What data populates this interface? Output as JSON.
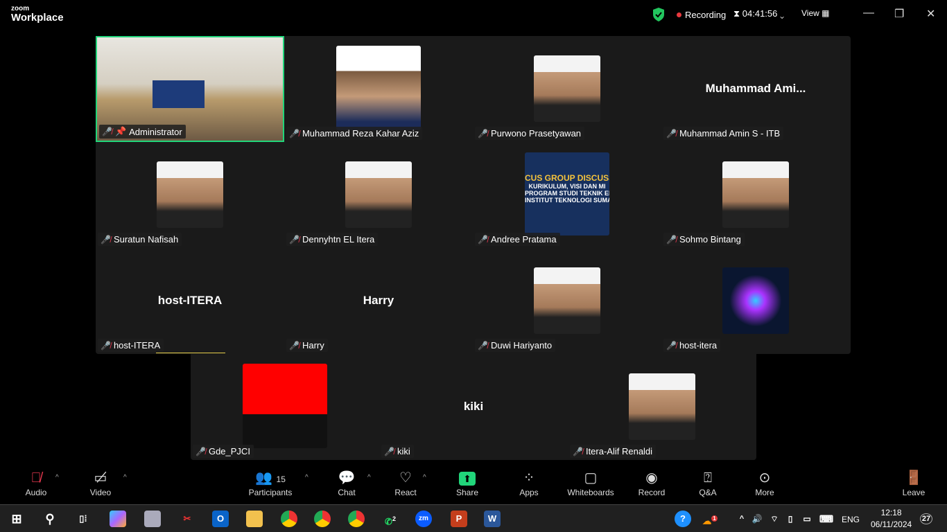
{
  "app": {
    "brand_small": "zoom",
    "brand": "Workplace"
  },
  "header": {
    "recording": "Recording",
    "timer": "04:41:56",
    "view": "View"
  },
  "colors": {
    "active_speaker": "#21d57a",
    "muted": "#e8384f",
    "share": "#21d57a",
    "leave": "#e8384f"
  },
  "tiles": [
    {
      "name": "Administrator",
      "kind": "video",
      "active": true,
      "pinned": true
    },
    {
      "name": "Muhammad Reza Kahar Aziz",
      "kind": "photo-big"
    },
    {
      "name": "Purwono Prasetyawan",
      "kind": "photo"
    },
    {
      "name": "Muhammad Amin S - ITB",
      "kind": "text",
      "display": "Muhammad  Ami..."
    },
    {
      "name": "Suratun Nafisah",
      "kind": "photo"
    },
    {
      "name": "Dennyhtn EL Itera",
      "kind": "photo"
    },
    {
      "name": "Andree Pratama",
      "kind": "poster",
      "poster": [
        "CUS GROUP DISCUSS",
        "KURIKULUM, VISI DAN MI",
        "PROGRAM STUDI TEKNIK ELEKTRO",
        "INSTITUT TEKNOLOGI SUMATERA"
      ]
    },
    {
      "name": "Sohmo Bintang",
      "kind": "photo"
    },
    {
      "name": "host-ITERA",
      "kind": "text",
      "display": "host-ITERA"
    },
    {
      "name": "Harry",
      "kind": "text",
      "display": "Harry"
    },
    {
      "name": "Duwi Hariyanto",
      "kind": "photo"
    },
    {
      "name": "host-itera",
      "kind": "abstract"
    },
    {
      "name": "Gde_PJCI",
      "kind": "photo-red"
    },
    {
      "name": "kiki",
      "kind": "text",
      "display": "kiki"
    },
    {
      "name": "Itera-Alif Renaldi",
      "kind": "photo"
    }
  ],
  "toolbar": {
    "audio": "Audio",
    "video": "Video",
    "participants": "Participants",
    "participants_count": "15",
    "chat": "Chat",
    "react": "React",
    "share": "Share",
    "apps": "Apps",
    "whiteboards": "Whiteboards",
    "record": "Record",
    "qa": "Q&A",
    "more": "More",
    "leave": "Leave"
  },
  "taskbar": {
    "lang": "ENG",
    "time": "12:18",
    "date": "06/11/2024",
    "notifications": "27",
    "whatsapp_badge": "2",
    "weather_badge": "1",
    "zoom_label": "zm"
  }
}
